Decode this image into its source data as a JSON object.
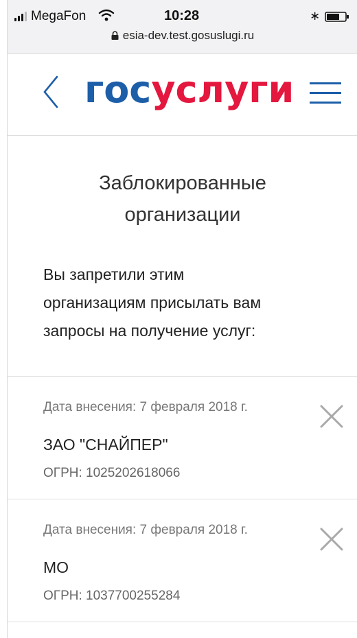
{
  "status_bar": {
    "carrier": "MegaFon",
    "time": "10:28",
    "url": "esia-dev.test.gosuslugi.ru",
    "icons": [
      "signal-icon",
      "wifi-icon",
      "bluetooth-icon",
      "battery-icon",
      "lock-icon"
    ]
  },
  "header": {
    "logo_part1": "гос",
    "logo_part2": "услуги",
    "colors": {
      "brand_blue": "#1c5ea8",
      "brand_red": "#e4173e"
    },
    "icons": [
      "back-icon",
      "menu-icon"
    ]
  },
  "main": {
    "title_line1": "Заблокированные",
    "title_line2": "организации",
    "desc_line1": "Вы запретили этим",
    "desc_line2": "организациям присылать вам",
    "desc_line3": "запросы на получение услуг:",
    "items": [
      {
        "date": "Дата внесения: 7 февраля 2018 г.",
        "name": "ЗАО \"СНАЙПЕР\"",
        "ogrn": "ОГРН: 1025202618066"
      },
      {
        "date": "Дата внесения: 7 февраля 2018 г.",
        "name": "МО",
        "ogrn": "ОГРН: 1037700255284"
      }
    ]
  }
}
